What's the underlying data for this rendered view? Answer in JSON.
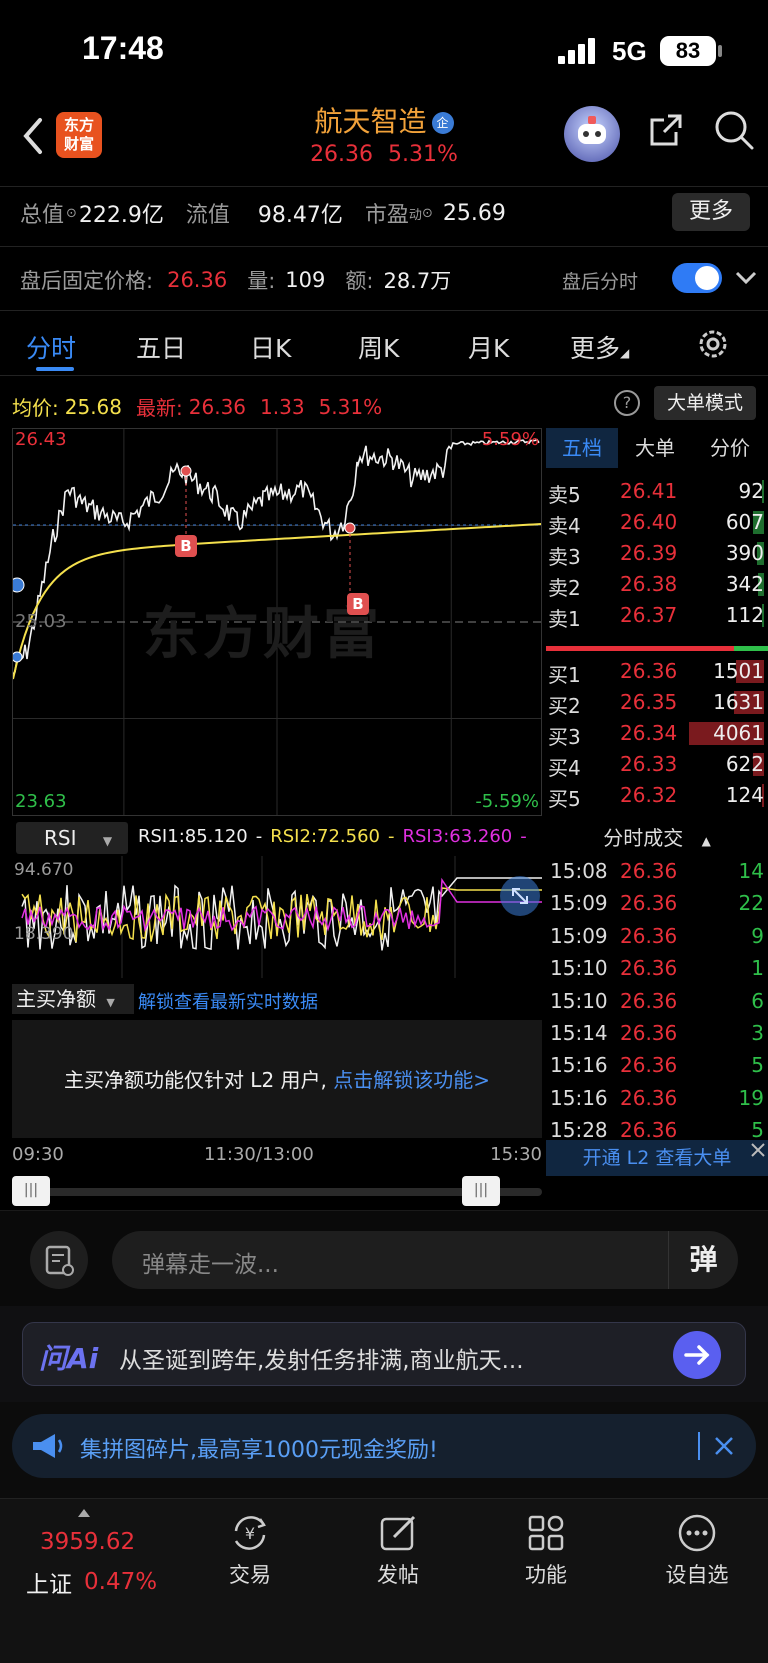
{
  "status_bar": {
    "time": "17:48",
    "network": "5G",
    "battery": "83"
  },
  "header": {
    "logo_line1": "东方",
    "logo_line2": "财富",
    "title": "航天智造",
    "badge": "企",
    "price": "26.36",
    "change_pct": "5.31%"
  },
  "stats": {
    "total_label": "总值",
    "total_value": "222.9亿",
    "float_label": "流值",
    "float_value": "98.47亿",
    "pe_label": "市盈",
    "pe_sup": "动",
    "pe_value": "25.69",
    "more_button": "更多"
  },
  "afterhours": {
    "label": "盘后固定价格:",
    "price": "26.36",
    "vol_label": "量:",
    "vol": "109",
    "amt_label": "额:",
    "amt": "28.7万",
    "toggle_label": "盘后分时",
    "toggle_on": true
  },
  "tabs": {
    "items": [
      "分时",
      "五日",
      "日K",
      "周K",
      "月K",
      "更多"
    ],
    "active": 0
  },
  "chart_info": {
    "avg_label": "均价:",
    "avg_value": "25.68",
    "last_label": "最新:",
    "last_value": "26.36",
    "change": "1.33",
    "change_pct": "5.31%",
    "mode_button": "大单模式",
    "top_price": "26.43",
    "top_pct": "5.59%",
    "bottom_price": "23.63",
    "bottom_pct": "-5.59%",
    "mid_price": "25.03",
    "watermark": "东方财富",
    "marker_b": "B"
  },
  "order_book": {
    "tabs": [
      "五档",
      "大单",
      "分价"
    ],
    "asks": [
      {
        "label": "卖5",
        "price": "26.41",
        "vol": "92"
      },
      {
        "label": "卖4",
        "price": "26.40",
        "vol": "607"
      },
      {
        "label": "卖3",
        "price": "26.39",
        "vol": "390"
      },
      {
        "label": "卖2",
        "price": "26.38",
        "vol": "342"
      },
      {
        "label": "卖1",
        "price": "26.37",
        "vol": "112"
      }
    ],
    "bids": [
      {
        "label": "买1",
        "price": "26.36",
        "vol": "1501"
      },
      {
        "label": "买2",
        "price": "26.35",
        "vol": "1631"
      },
      {
        "label": "买3",
        "price": "26.34",
        "vol": "4061"
      },
      {
        "label": "买4",
        "price": "26.33",
        "vol": "622"
      },
      {
        "label": "买5",
        "price": "26.32",
        "vol": "124"
      }
    ]
  },
  "rsi": {
    "selector": "RSI",
    "rsi1_label": "RSI1:85.120",
    "rsi2_label": "RSI2:72.560",
    "rsi3_label": "RSI3:63.260",
    "max": "94.670",
    "min": "18.390"
  },
  "trades": {
    "header": "分时成交",
    "rows": [
      {
        "time": "15:08",
        "price": "26.36",
        "vol": "14",
        "color": "#2fbf4a"
      },
      {
        "time": "15:09",
        "price": "26.36",
        "vol": "22",
        "color": "#2fbf4a"
      },
      {
        "time": "15:09",
        "price": "26.36",
        "vol": "9",
        "color": "#2fbf4a"
      },
      {
        "time": "15:10",
        "price": "26.36",
        "vol": "1",
        "color": "#2fbf4a"
      },
      {
        "time": "15:10",
        "price": "26.36",
        "vol": "6",
        "color": "#2fbf4a"
      },
      {
        "time": "15:14",
        "price": "26.36",
        "vol": "3",
        "color": "#2fbf4a"
      },
      {
        "time": "15:16",
        "price": "26.36",
        "vol": "5",
        "color": "#2fbf4a"
      },
      {
        "time": "15:16",
        "price": "26.36",
        "vol": "19",
        "color": "#2fbf4a"
      },
      {
        "time": "15:28",
        "price": "26.36",
        "vol": "5",
        "color": "#2fbf4a"
      }
    ],
    "l2_banner": "开通 L2 查看大单"
  },
  "net_buy": {
    "selector": "主买净额",
    "unlock_link": "解锁查看最新实时数据",
    "notice": "主买净额功能仅针对 L2 用户,",
    "notice_link": "点击解锁该功能>"
  },
  "time_axis": {
    "start": "09:30",
    "mid": "11:30/13:00",
    "end": "15:30"
  },
  "comment": {
    "placeholder": "弹幕走一波...",
    "danmu_icon_label": "弹"
  },
  "ai_bar": {
    "logo": "问Ai",
    "text": "从圣诞到跨年,发射任务排满,商业航天..."
  },
  "promo": {
    "text": "集拼图碎片,最高享1000元现金奖励!"
  },
  "bottom_nav": {
    "index_value": "3959.62",
    "index_name": "上证",
    "index_pct": "0.47%",
    "items": [
      "交易",
      "发帖",
      "功能",
      "设自选"
    ]
  },
  "colors": {
    "up": "#e8303a",
    "down": "#2fbf4a",
    "accent": "#3a7bd5",
    "avg_line": "#f4e04d"
  }
}
